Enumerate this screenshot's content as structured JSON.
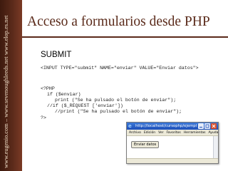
{
  "side": {
    "text": "www.eugenio.com – www.sevenoughleeds.net  www.elop.es.net"
  },
  "slide": {
    "title": "Acceso a formularios desde PHP",
    "section": "SUBMIT"
  },
  "code": {
    "input_line": "<INPUT TYPE=\"submit\" NAME=\"enviar\" VALUE=\"Enviar datos\">",
    "php_open": "<?PHP",
    "if_line": "if ($enviar)",
    "print_line": "print (\"Se ha pulsado el botón de enviar\");",
    "comment_if": "//if ($_REQUEST ['enviar'])",
    "comment_print": "//print (\"Se ha pulsado el botón de enviar\");",
    "php_close": "?>"
  },
  "browser": {
    "title": "http://localhost/cursophp/ejemplos/elementos.php - Micro...",
    "menu": [
      "Archivo",
      "Edición",
      "Ver",
      "Favoritos",
      "Herramientas",
      "Ayuda"
    ],
    "button_label": "Enviar datos"
  }
}
